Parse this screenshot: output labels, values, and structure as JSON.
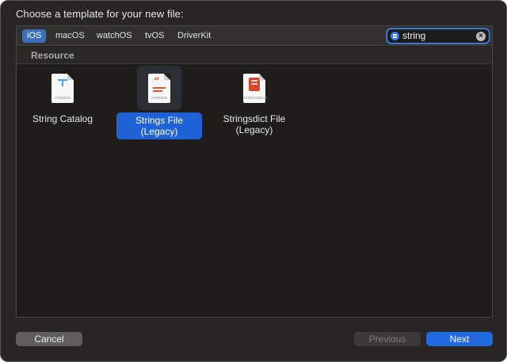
{
  "dialog": {
    "title": "Choose a template for your new file:"
  },
  "platform_tabs": [
    {
      "label": "iOS",
      "selected": true
    },
    {
      "label": "macOS",
      "selected": false
    },
    {
      "label": "watchOS",
      "selected": false
    },
    {
      "label": "tvOS",
      "selected": false
    },
    {
      "label": "DriverKit",
      "selected": false
    }
  ],
  "search": {
    "value": "string",
    "icon": "filter-icon",
    "clear_icon": "clear-icon"
  },
  "section": {
    "label": "Resource"
  },
  "templates": [
    {
      "label": "String Catalog",
      "icon": "string-catalog-icon",
      "icon_caption": "STRINGS",
      "selected": false
    },
    {
      "label": "Strings File (Legacy)",
      "label_line1": "Strings File",
      "label_line2": "(Legacy)",
      "icon": "strings-file-icon",
      "icon_caption": "STRINGS",
      "selected": true
    },
    {
      "label": "Stringsdict File (Legacy)",
      "label_line1": "Stringsdict File",
      "label_line2": "(Legacy)",
      "icon": "stringsdict-file-icon",
      "icon_caption": "STRINGSDICT",
      "selected": false
    }
  ],
  "buttons": {
    "cancel": "Cancel",
    "previous": "Previous",
    "next": "Next"
  },
  "colors": {
    "accent": "#2169e0",
    "selection": "#1f62d6",
    "background": "#282624"
  }
}
